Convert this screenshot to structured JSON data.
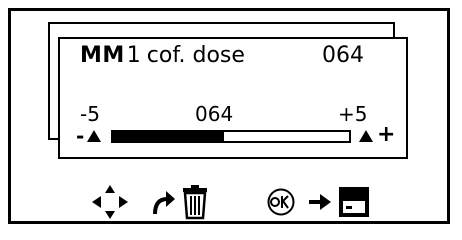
{
  "screen": {
    "mode": "MM",
    "channel": "1",
    "label": "cof. dose",
    "value": "064"
  },
  "scale": {
    "min_label": "-5",
    "current_label": "064",
    "max_label": "+5",
    "minus_symbol": "-",
    "plus_symbol": "+",
    "level_fraction": 0.47
  },
  "footer_icons": [
    "navigate-dpad-icon",
    "turn-arrow-icon",
    "trash-icon",
    "ok-button-icon",
    "right-arrow-icon",
    "save-icon"
  ]
}
